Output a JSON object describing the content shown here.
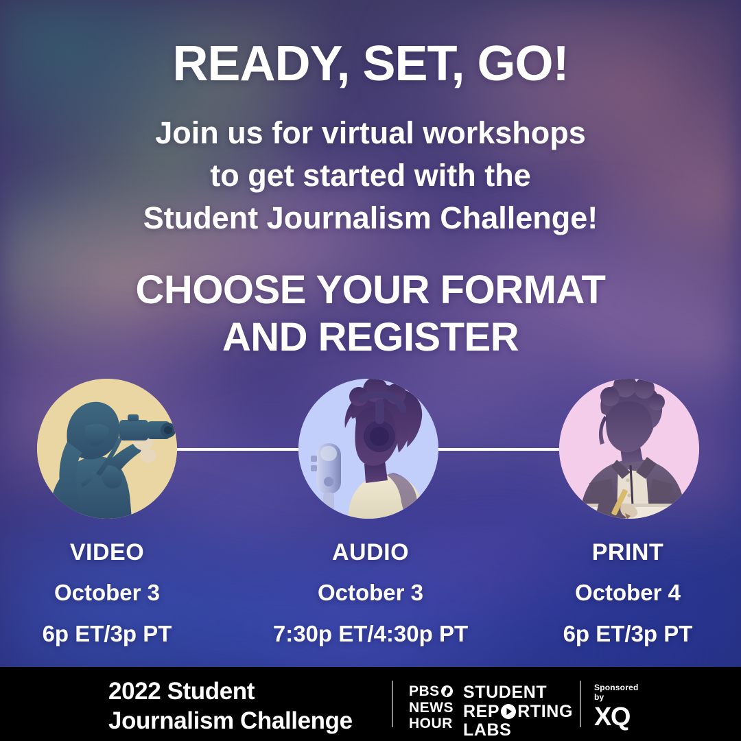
{
  "headline": {
    "title": "READY, SET, GO!",
    "subtitle_lines": [
      "Join us for virtual workshops",
      "to get started with the",
      "Student Journalism Challenge!"
    ],
    "cta_lines": [
      "CHOOSE YOUR FORMAT",
      "AND REGISTER"
    ]
  },
  "formats": [
    {
      "name": "VIDEO",
      "date": "October 3",
      "time": "6p ET/3p PT",
      "circle_bg": "#e9d6a3",
      "photo_alt": "photographer-with-camera",
      "icon": "video-camera-icon"
    },
    {
      "name": "AUDIO",
      "date": "October 3",
      "time": "7:30p ET/4:30p PT",
      "circle_bg": "#c3cffb",
      "photo_alt": "person-with-headphones-at-microphone",
      "icon": "microphone-icon"
    },
    {
      "name": "PRINT",
      "date": "October 4",
      "time": "6p ET/3p PT",
      "circle_bg": "#f4cdeb",
      "photo_alt": "person-writing-with-pencil",
      "icon": "pencil-icon"
    }
  ],
  "footer": {
    "program_line1": "2022 Student",
    "program_line2": "Journalism Challenge",
    "pbs": {
      "line1": "PBS",
      "line2": "NEWS",
      "line3": "HOUR"
    },
    "srl": {
      "line1": "STUDENT",
      "line2_a": "REP",
      "line2_b": "RTING",
      "line3": "LABS"
    },
    "sponsor": {
      "label_line1": "Sponsored",
      "label_line2": "by",
      "brand": "XQ"
    }
  },
  "colors": {
    "footer_bg": "#000000",
    "text": "#ffffff",
    "divider": "#8d8d8d",
    "bg_deep_blue": "#2b3e9e",
    "bg_purple": "#4a3f87",
    "bg_teal": "#427480",
    "bg_pink": "#c5848e"
  }
}
